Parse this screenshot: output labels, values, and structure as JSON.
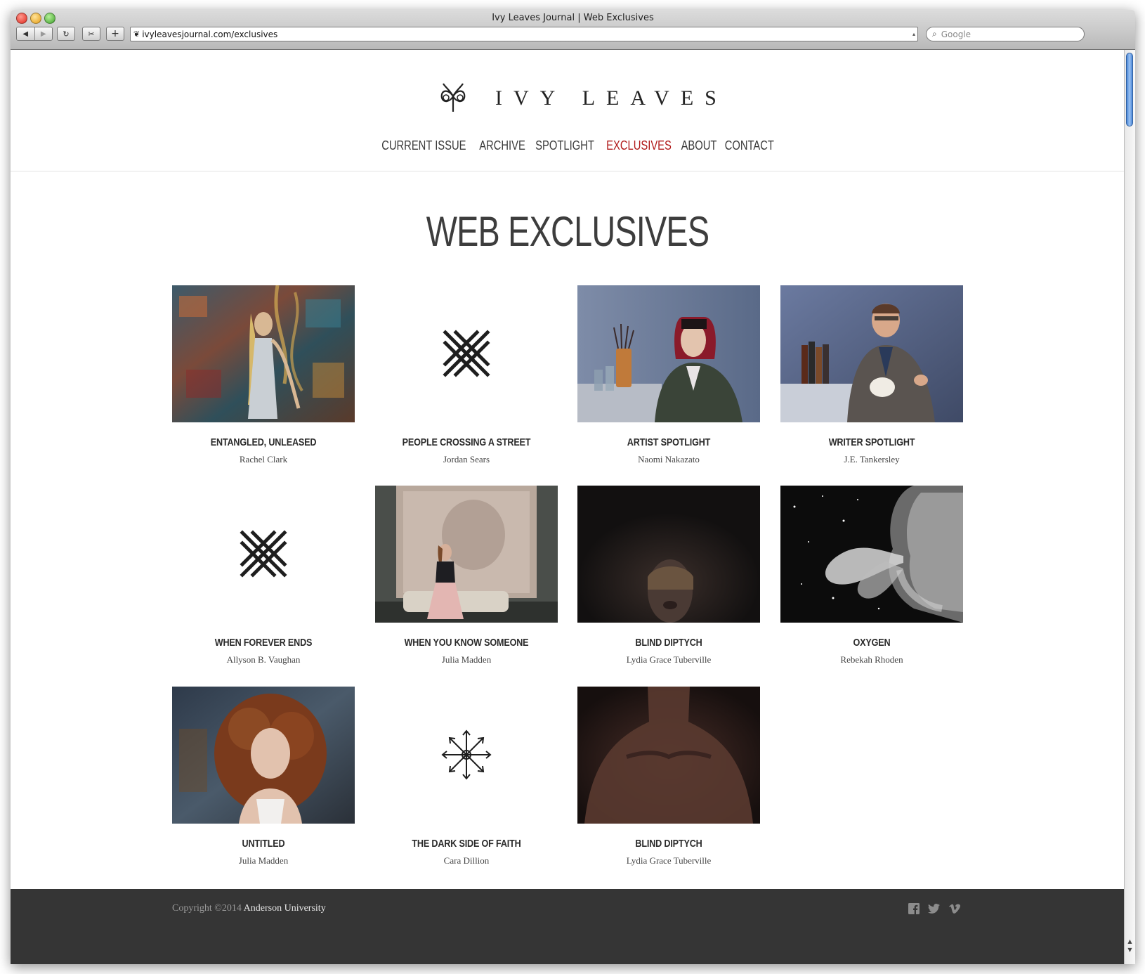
{
  "browser": {
    "window_title": "Ivy Leaves Journal | Web Exclusives",
    "url": "ivyleavesjournal.com/exclusives",
    "search_placeholder": "Google"
  },
  "site": {
    "logo_text": "IVY LEAVES",
    "nav": [
      {
        "label": "CURRENT ISSUE",
        "active": false
      },
      {
        "label": "ARCHIVE",
        "active": false
      },
      {
        "label": "SPOTLIGHT",
        "active": false
      },
      {
        "label": "EXCLUSIVES",
        "active": true
      },
      {
        "label": "ABOUT",
        "active": false
      },
      {
        "label": "CONTACT",
        "active": false
      }
    ],
    "accent_color": "#b01818"
  },
  "main": {
    "title": "WEB EXCLUSIVES",
    "items": [
      {
        "title": "ENTANGLED, UNLEASED",
        "author": "Rachel Clark",
        "thumb": "painting-image"
      },
      {
        "title": "PEOPLE CROSSING A STREET",
        "author": "Jordan Sears",
        "thumb": "lattice-icon"
      },
      {
        "title": "ARTIST SPOTLIGHT",
        "author": "Naomi Nakazato",
        "thumb": "artist-photo"
      },
      {
        "title": "WRITER SPOTLIGHT",
        "author": "J.E. Tankersley",
        "thumb": "writer-photo"
      },
      {
        "title": "WHEN FOREVER ENDS",
        "author": "Allyson B. Vaughan",
        "thumb": "lattice-icon"
      },
      {
        "title": "WHEN YOU KNOW SOMEONE",
        "author": "Julia Madden",
        "thumb": "woman-room-photo"
      },
      {
        "title": "BLIND DIPTYCH",
        "author": "Lydia Grace Tuberville",
        "thumb": "dark-portrait-photo"
      },
      {
        "title": "OXYGEN",
        "author": "Rebekah Rhoden",
        "thumb": "smoke-portrait-photo"
      },
      {
        "title": "UNTITLED",
        "author": "Julia Madden",
        "thumb": "curly-hair-portrait-photo"
      },
      {
        "title": "THE DARK SIDE OF FAITH",
        "author": "Cara Dillion",
        "thumb": "snowflake-icon"
      },
      {
        "title": "BLIND DIPTYCH",
        "author": "Lydia Grace Tuberville",
        "thumb": "dark-torso-photo"
      }
    ]
  },
  "footer": {
    "copyright_prefix": "Copyright ©2014",
    "copyright_owner": "Anderson University",
    "social_icons": [
      "facebook-icon",
      "twitter-icon",
      "vimeo-icon"
    ]
  }
}
